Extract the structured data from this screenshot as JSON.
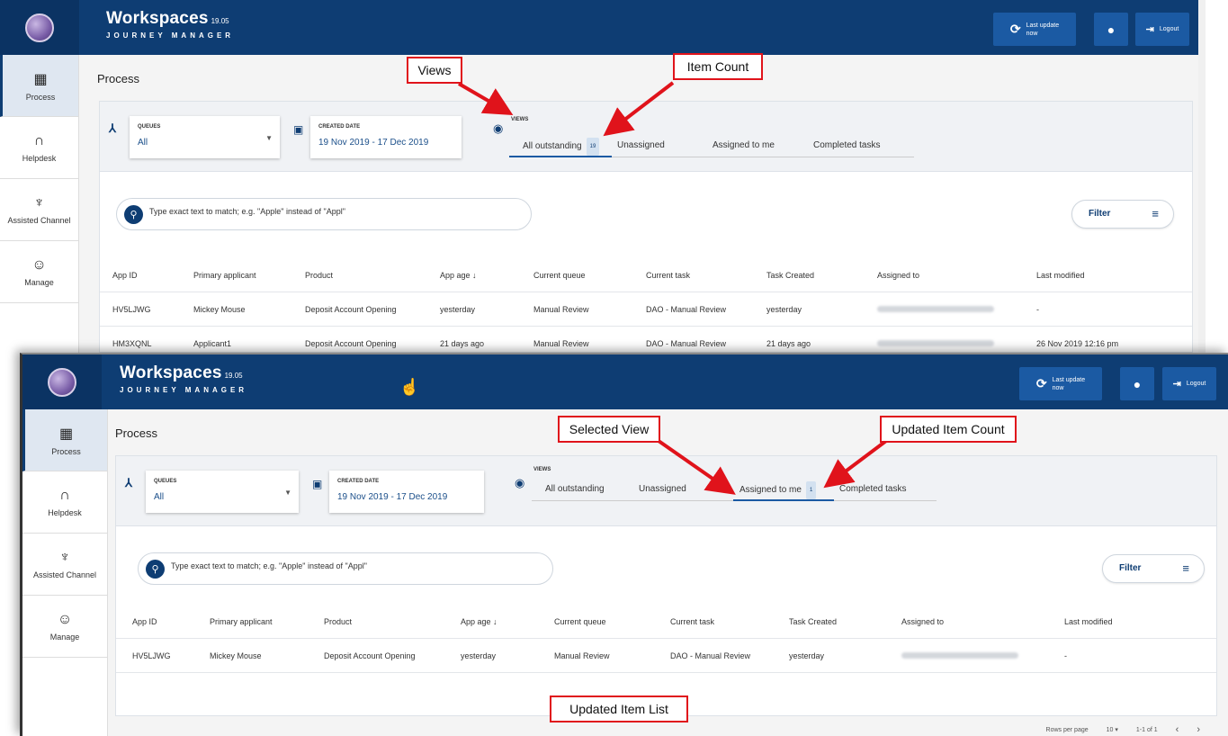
{
  "app": {
    "title": "Workspaces",
    "version": "19.05",
    "subtitle": "JOURNEY MANAGER",
    "last_update_label": "Last update",
    "last_update_value": "now",
    "logout_label": "Logout",
    "brand_color": "#0e3d73"
  },
  "sidebar": {
    "items": [
      {
        "label": "Process",
        "icon": "process-icon"
      },
      {
        "label": "Helpdesk",
        "icon": "headset-icon"
      },
      {
        "label": "Assisted Channel",
        "icon": "person-icon"
      },
      {
        "label": "Manage",
        "icon": "palette-icon"
      }
    ]
  },
  "page": {
    "title": "Process"
  },
  "filters": {
    "queues_label": "QUEUES",
    "queues_value": "All",
    "created_label": "CREATED DATE",
    "created_value": "19 Nov 2019 - 17 Dec 2019",
    "views_label": "VIEWS"
  },
  "shot1": {
    "tabs": [
      "All outstanding",
      "Unassigned",
      "Assigned to me",
      "Completed tasks"
    ],
    "active_tab": "All outstanding",
    "active_count": "19"
  },
  "shot2": {
    "tabs": [
      "All outstanding",
      "Unassigned",
      "Assigned to me",
      "Completed tasks"
    ],
    "active_tab": "Assigned to me",
    "active_count": "1"
  },
  "search": {
    "placeholder": "Type exact text to match; e.g. \"Apple\" instead of \"Appl\""
  },
  "filter_button": "Filter",
  "table": {
    "columns": [
      "App ID",
      "Primary applicant",
      "Product",
      "App age ↓",
      "Current queue",
      "Current task",
      "Task Created",
      "Assigned to",
      "Last modified"
    ],
    "rows_shot1": [
      [
        "HV5LJWG",
        "Mickey Mouse",
        "Deposit Account Opening",
        "yesterday",
        "Manual Review",
        "DAO - Manual Review",
        "yesterday",
        "",
        "-"
      ],
      [
        "HM3XQNL",
        "Applicant1",
        "Deposit Account Opening",
        "21 days ago",
        "Manual Review",
        "DAO - Manual Review",
        "21 days ago",
        "",
        "26 Nov 2019 12:16 pm"
      ]
    ],
    "rows_shot2": [
      [
        "HV5LJWG",
        "Mickey Mouse",
        "Deposit Account Opening",
        "yesterday",
        "Manual Review",
        "DAO - Manual Review",
        "yesterday",
        "",
        "-"
      ]
    ]
  },
  "pager": {
    "rows_per_page_label": "Rows per page",
    "rows_per_page_value": "10",
    "range": "1-1 of 1"
  },
  "annotations": {
    "views": "Views",
    "item_count": "Item Count",
    "selected_view": "Selected View",
    "updated_item_count": "Updated Item Count",
    "updated_item_list": "Updated Item List",
    "color": "#e0131b"
  }
}
